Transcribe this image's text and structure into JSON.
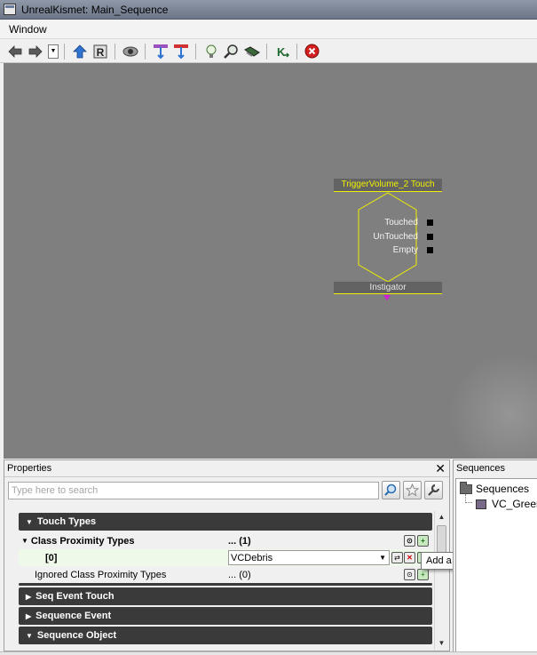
{
  "window": {
    "title": "UnrealKismet: Main_Sequence"
  },
  "menu": {
    "items": [
      "Window"
    ]
  },
  "toolbar": {
    "icons": [
      "back-arrow-icon",
      "forward-arrow-icon",
      "history-dropdown",
      "parent-sequence-icon",
      "rename-sequence-icon",
      "hide-connectors-icon",
      "show-all-icon",
      "show-selected-icon",
      "search-bulb-icon",
      "zoom-icon",
      "open-sequence-icon",
      "create-sequence-icon",
      "delete-icon"
    ]
  },
  "node": {
    "title": "TriggerVolume_2 Touch",
    "outputs": [
      "Touched",
      "UnTouched",
      "Empty"
    ],
    "variable": "Instigator",
    "colors": {
      "border": "#f0f000",
      "header": "#636363",
      "variable_arrow": "#d020d0"
    }
  },
  "properties": {
    "header": "Properties",
    "close": "✕",
    "search_placeholder": "Type here to search",
    "categories": {
      "touch_types": "Touch Types",
      "seq_event_touch": "Seq Event Touch",
      "sequence_event": "Sequence Event",
      "sequence_object": "Sequence Object"
    },
    "rows": {
      "class_proximity": {
        "name": "Class Proximity Types",
        "value": "... (1)"
      },
      "item0": {
        "name": "[0]",
        "value": "VCDebris"
      },
      "ignored": {
        "name": "Ignored Class Proximity Types",
        "value": "... (0)"
      }
    },
    "tooltip": "Add a new item"
  },
  "sequences": {
    "header": "Sequences",
    "root": "Sequences",
    "child": "VC_Green"
  }
}
